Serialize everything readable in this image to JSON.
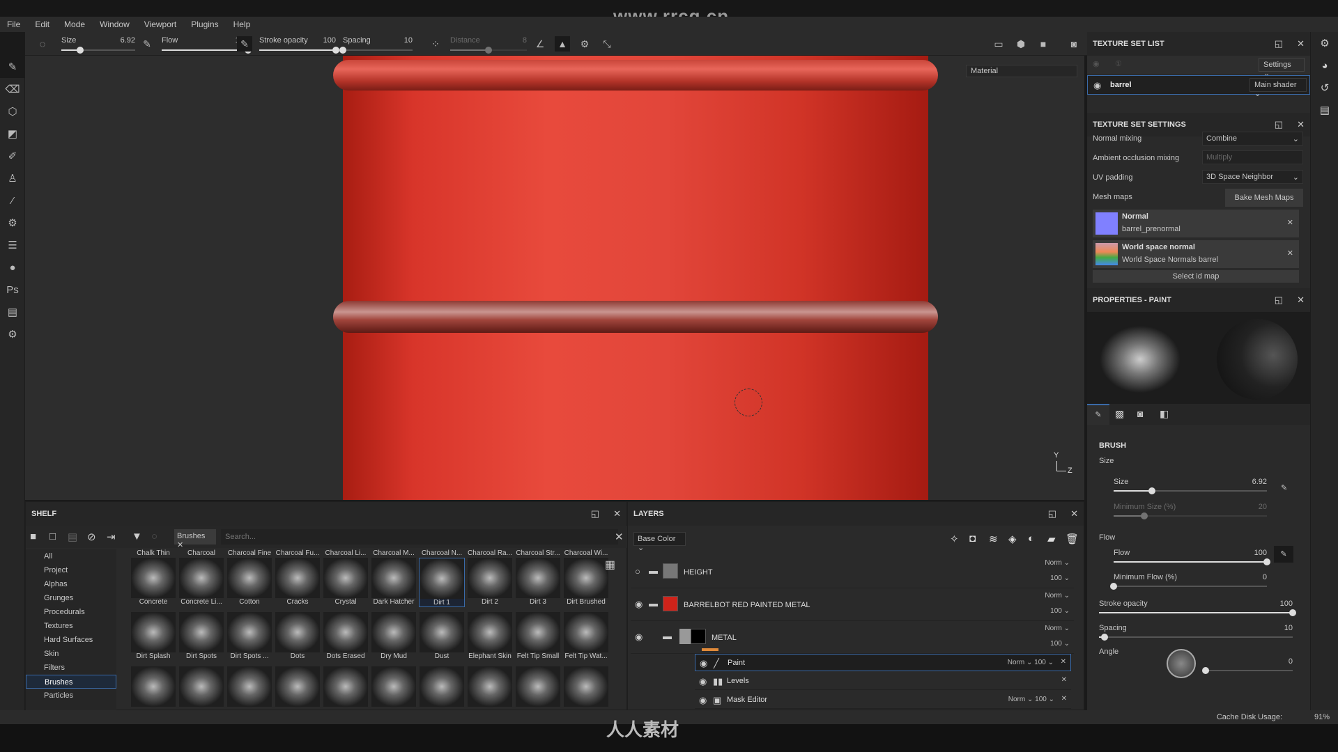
{
  "watermark": "www.rrcg.cn",
  "logo": "人人素材",
  "menu": [
    "File",
    "Edit",
    "Mode",
    "Window",
    "Viewport",
    "Plugins",
    "Help"
  ],
  "toolbar": {
    "size": {
      "label": "Size",
      "value": "6.92",
      "fraction": 0.25
    },
    "flow": {
      "label": "Flow",
      "value": "100",
      "fraction": 1.0
    },
    "stroke_opacity": {
      "label": "Stroke opacity",
      "value": "100",
      "fraction": 1.0
    },
    "spacing": {
      "label": "Spacing",
      "value": "10",
      "fraction": 0.0
    },
    "distance": {
      "label": "Distance",
      "value": "8",
      "fraction": 0.5
    }
  },
  "viewport": {
    "material_select": "Material",
    "axis_y": "Y",
    "axis_z": "Z",
    "accent": "#d8352a"
  },
  "shelf": {
    "title": "SHELF",
    "filter_tag": "Brushes",
    "search_placeholder": "Search...",
    "categories": [
      "All",
      "Project",
      "Alphas",
      "Grunges",
      "Procedurals",
      "Textures",
      "Hard Surfaces",
      "Skin",
      "Filters",
      "Brushes",
      "Particles"
    ],
    "selected_category": "Brushes",
    "top_row_labels": [
      "Chalk Thin",
      "Charcoal",
      "Charcoal Fine",
      "Charcoal Fu...",
      "Charcoal Li...",
      "Charcoal M...",
      "Charcoal N...",
      "Charcoal Ra...",
      "Charcoal Str...",
      "Charcoal Wi..."
    ],
    "brushes": [
      "Concrete",
      "Concrete Li...",
      "Cotton",
      "Cracks",
      "Crystal",
      "Dark Hatcher",
      "Dirt 1",
      "Dirt 2",
      "Dirt 3",
      "Dirt Brushed",
      "Dirt Splash",
      "Dirt Spots",
      "Dirt Spots ...",
      "Dots",
      "Dots Erased",
      "Dry Mud",
      "Dust",
      "Elephant Skin",
      "Felt Tip Small",
      "Felt Tip Wat..."
    ],
    "selected_brush": "Dirt 1"
  },
  "layers": {
    "title": "LAYERS",
    "channel": "Base Color",
    "items": [
      {
        "name": "HEIGHT",
        "blend": "Norm",
        "opacity": "100",
        "visible": false
      },
      {
        "name": "BARRELBOT RED PAINTED METAL",
        "blend": "Norm",
        "opacity": "100",
        "visible": true
      },
      {
        "name": "METAL",
        "blend": "Norm",
        "opacity": "100",
        "visible": true
      }
    ],
    "effects": [
      {
        "name": "Paint",
        "blend": "Norm",
        "opacity": "100",
        "icon": "brush-icon"
      },
      {
        "name": "Levels",
        "blend": "",
        "opacity": "",
        "icon": "levels-icon"
      },
      {
        "name": "Mask Editor",
        "blend": "Norm",
        "opacity": "100",
        "icon": "mask-icon"
      }
    ]
  },
  "texture_set_list": {
    "title": "TEXTURE SET LIST",
    "settings": "Settings",
    "item": "barrel",
    "shader": "Main shader"
  },
  "texture_set_settings": {
    "title": "TEXTURE SET SETTINGS",
    "normal_mixing": {
      "label": "Normal mixing",
      "value": "Combine"
    },
    "ao_mixing": {
      "label": "Ambient occlusion mixing",
      "value": "Multiply"
    },
    "uv_padding": {
      "label": "UV padding",
      "value": "3D Space Neighbor"
    },
    "mesh_maps": {
      "label": "Mesh maps",
      "button": "Bake Mesh Maps"
    },
    "maps": [
      {
        "name": "Normal",
        "file": "barrel_prenormal",
        "color": "#8080ff"
      },
      {
        "name": "World space normal",
        "file": "World Space Normals barrel",
        "color": "#9a6a9a"
      }
    ],
    "select_id": "Select id map"
  },
  "properties": {
    "title": "PROPERTIES - PAINT",
    "section": "BRUSH",
    "size_group": "Size",
    "size": {
      "label": "Size",
      "value": "6.92",
      "fraction": 0.25
    },
    "min_size": {
      "label": "Minimum Size (%)",
      "value": "20",
      "fraction": 0.2
    },
    "flow_group": "Flow",
    "flow": {
      "label": "Flow",
      "value": "100",
      "fraction": 1.0
    },
    "min_flow": {
      "label": "Minimum Flow (%)",
      "value": "0",
      "fraction": 0.0
    },
    "stroke_opacity": {
      "label": "Stroke opacity",
      "value": "100",
      "fraction": 1.0
    },
    "spacing": {
      "label": "Spacing",
      "value": "10",
      "fraction": 0.03
    },
    "angle": {
      "label": "Angle",
      "value": "0",
      "fraction": 0.0
    }
  },
  "status": {
    "cache_label": "Cache Disk Usage:",
    "cache_value": "91%"
  }
}
